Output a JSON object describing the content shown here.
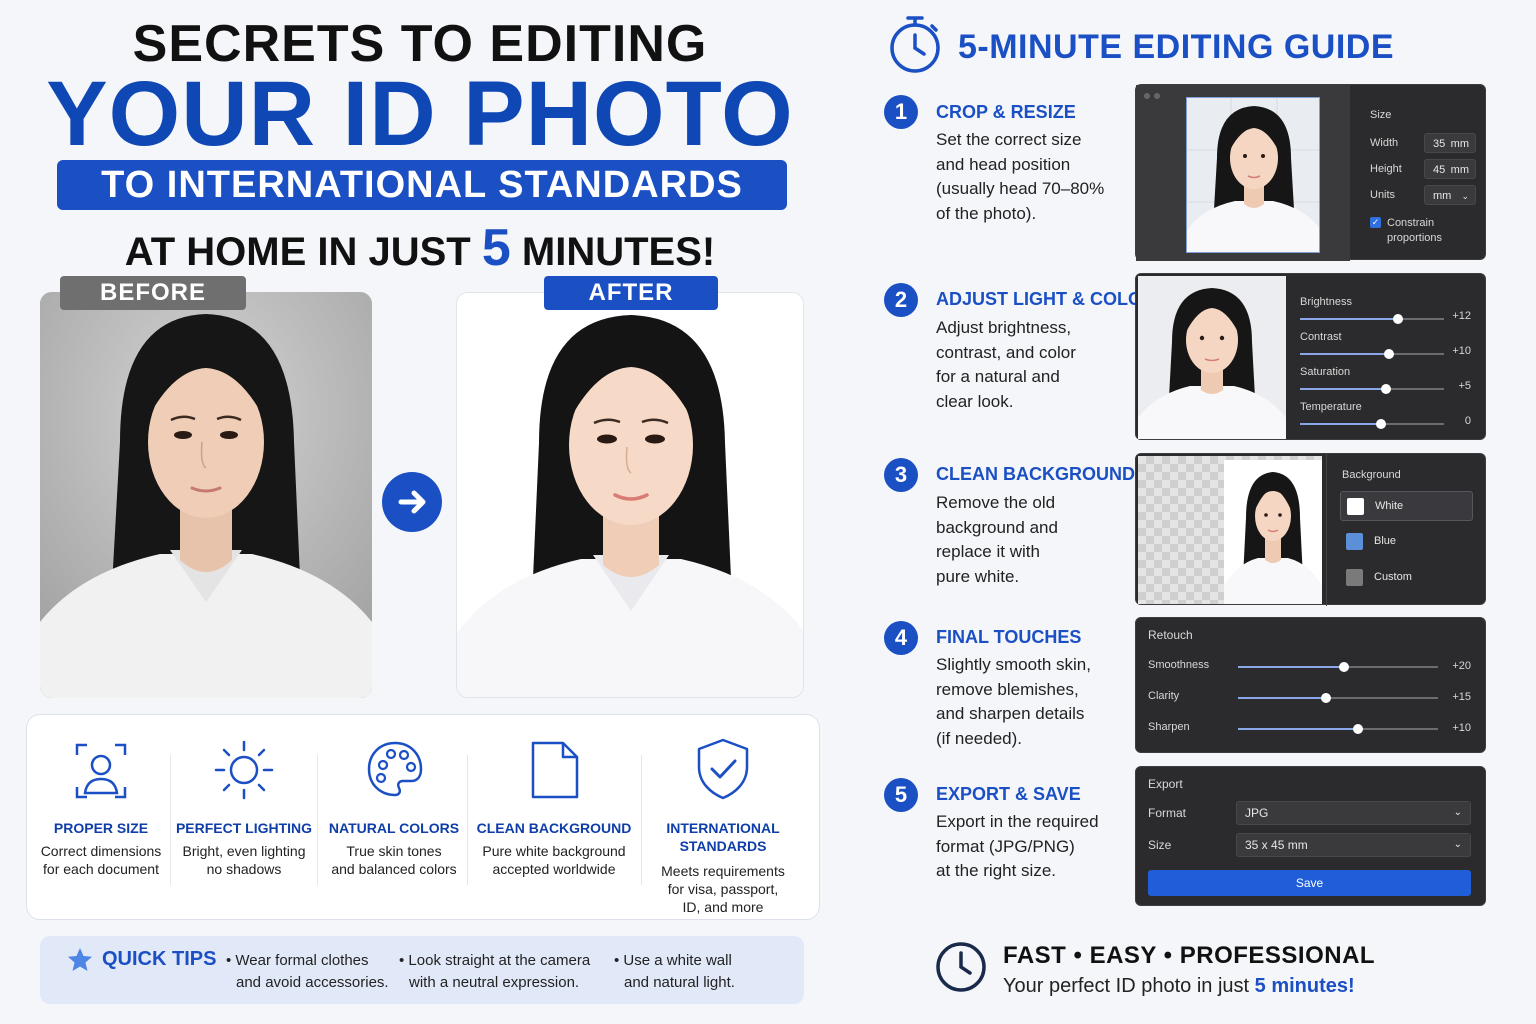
{
  "headline": {
    "line1": "SECRETS TO EDITING",
    "line2": "YOUR ID PHOTO",
    "line3": "TO INTERNATIONAL STANDARDS",
    "line4_a": "AT HOME IN JUST ",
    "line4_num": "5",
    "line4_b": " MINUTES!"
  },
  "comparison": {
    "before_label": "BEFORE",
    "after_label": "AFTER"
  },
  "features": [
    {
      "icon": "user-frame-icon",
      "title": "PROPER SIZE",
      "desc1": "Correct dimensions",
      "desc2": "for each document",
      "desc3": ""
    },
    {
      "icon": "sun-icon",
      "title": "PERFECT LIGHTING",
      "desc1": "Bright, even lighting",
      "desc2": "no shadows",
      "desc3": ""
    },
    {
      "icon": "palette-icon",
      "title": "NATURAL COLORS",
      "desc1": "True skin tones",
      "desc2": "and balanced colors",
      "desc3": ""
    },
    {
      "icon": "document-icon",
      "title": "CLEAN BACKGROUND",
      "desc1": "Pure white background",
      "desc2": "accepted worldwide",
      "desc3": ""
    },
    {
      "icon": "shield-check-icon",
      "title": "INTERNATIONAL",
      "title2": "STANDARDS",
      "desc1": "Meets requirements",
      "desc2": "for visa, passport,",
      "desc3": "ID, and more"
    }
  ],
  "tips": {
    "title": "QUICK TIPS",
    "items": [
      {
        "l1": "• Wear formal clothes",
        "l2": "and avoid accessories."
      },
      {
        "l1": "• Look straight at the camera",
        "l2": "with a neutral expression."
      },
      {
        "l1": "• Use a white wall",
        "l2": "and natural light."
      }
    ]
  },
  "guide": {
    "title": "5-MINUTE EDITING GUIDE",
    "steps": [
      {
        "num": "1",
        "title": "CROP & RESIZE",
        "lines": [
          "Set the correct size",
          "and head position",
          "(usually head 70–80%",
          "of the photo)."
        ]
      },
      {
        "num": "2",
        "title": "ADJUST LIGHT & COLOR",
        "lines": [
          "Adjust brightness,",
          "contrast, and color",
          "for a natural and",
          "clear look."
        ]
      },
      {
        "num": "3",
        "title": "CLEAN BACKGROUND",
        "lines": [
          "Remove the old",
          "background and",
          "replace it with",
          "pure white."
        ]
      },
      {
        "num": "4",
        "title": "FINAL TOUCHES",
        "lines": [
          "Slightly smooth skin,",
          "remove blemishes,",
          "and sharpen details",
          "(if needed)."
        ]
      },
      {
        "num": "5",
        "title": "EXPORT & SAVE",
        "lines": [
          "Export in the required",
          "format (JPG/PNG)",
          "at the right size."
        ]
      }
    ]
  },
  "crop_panel": {
    "section": "Size",
    "width_label": "Width",
    "width_value": "35",
    "width_unit": "mm",
    "height_label": "Height",
    "height_value": "45",
    "height_unit": "mm",
    "units_label": "Units",
    "units_value": "mm",
    "constrain_l1": "Constrain",
    "constrain_l2": "proportions"
  },
  "light_panel": {
    "sliders": [
      {
        "label": "Brightness",
        "value": "+12",
        "level": 0.68
      },
      {
        "label": "Contrast",
        "value": "+10",
        "level": 0.62
      },
      {
        "label": "Saturation",
        "value": "+5",
        "level": 0.6
      },
      {
        "label": "Temperature",
        "value": "0",
        "level": 0.56
      }
    ]
  },
  "bg_panel": {
    "section": "Background",
    "options": [
      {
        "label": "White",
        "color": "#ffffff",
        "selected": true
      },
      {
        "label": "Blue",
        "color": "#5b8fd8",
        "selected": false
      },
      {
        "label": "Custom",
        "color": "#7a7a7a",
        "selected": false
      }
    ]
  },
  "retouch_panel": {
    "section": "Retouch",
    "sliders": [
      {
        "label": "Smoothness",
        "value": "+20",
        "level": 0.53
      },
      {
        "label": "Clarity",
        "value": "+15",
        "level": 0.44
      },
      {
        "label": "Sharpen",
        "value": "+10",
        "level": 0.6
      }
    ]
  },
  "export_panel": {
    "section": "Export",
    "format_label": "Format",
    "format_value": "JPG",
    "size_label": "Size",
    "size_value": "35 x 45 mm",
    "save_label": "Save"
  },
  "footer": {
    "title": "FAST • EASY • PROFESSIONAL",
    "sub_a": "Your perfect ID photo in just ",
    "sub_b": "5 minutes!"
  },
  "colors": {
    "accent": "#1b4fc4",
    "panel_bg": "#2b2b2d",
    "page_bg": "#f4f6fa"
  }
}
